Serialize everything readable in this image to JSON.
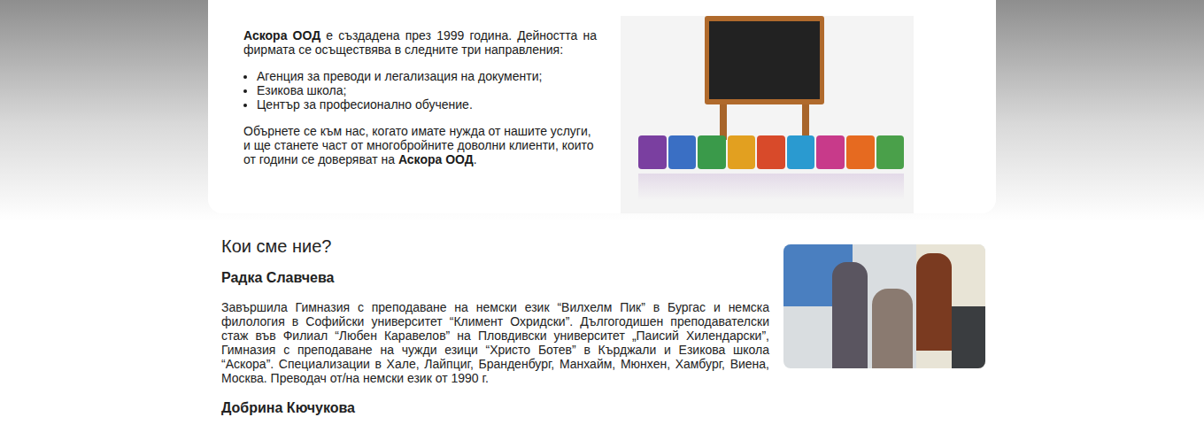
{
  "intro": {
    "company": "Аскора ООД",
    "text": " е създадена през 1999 година. Дейността на фирмата се осъществява в следните три направления:",
    "items": [
      "Агенция за преводи и легализация на документи;",
      "Езикова школа;",
      "Център за професионално обучение."
    ],
    "closing": "Обърнете се към нас, когато имате нужда от нашите услуги, и ще станете част от многобройните доволни клиенти, които от години се доверяват на ",
    "closing_company": "Аскора ООД",
    "closing_end": "."
  },
  "team": {
    "heading": "Кои сме ние?",
    "members": [
      {
        "name": "Радка Славчева",
        "bio": "Завършила Гимназия с преподаване на немски език “Вилхелм Пик” в Бургас и немска филология в Софийски университет “Климент Охридски”. Дългогодишен преподавателски стаж във Филиал “Любен Каравелов” на Пловдивски университет „Паисий Хилендарски”, Гимназия с преподаване на чужди езици “Христо Ботев” в Кърджали и Езикова школа “Аскора”. Специализации в Хале, Лайпциг, Бранденбург, Манхайм, Мюнхен, Хамбург, Виена, Москва. Преводач от/на немски език от 1990 г."
      },
      {
        "name": "Добрина Кючукова"
      }
    ]
  }
}
